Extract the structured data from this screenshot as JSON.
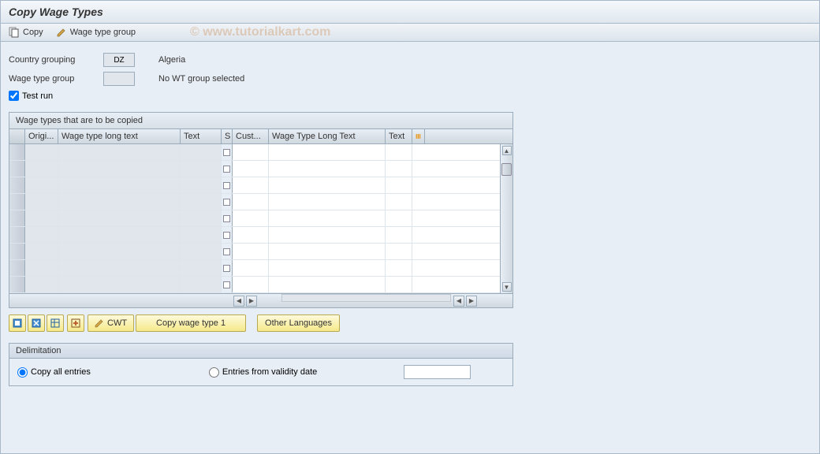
{
  "title": "Copy Wage Types",
  "toolbar": {
    "copy_label": "Copy",
    "wage_type_group_label": "Wage type group"
  },
  "watermark": "© www.tutorialkart.com",
  "form": {
    "country_grouping_label": "Country grouping",
    "country_grouping_value": "DZ",
    "country_grouping_text": "Algeria",
    "wage_type_group_label": "Wage type group",
    "wage_type_group_value": "",
    "wage_type_group_text": "No WT group selected",
    "test_run_label": "Test run",
    "test_run_checked": true
  },
  "table": {
    "title": "Wage types that are to be copied",
    "headers": {
      "origi": "Origi...",
      "long1": "Wage type long text",
      "text1": "Text",
      "s": "S",
      "cust": "Cust...",
      "long2": "Wage Type Long Text",
      "text2": "Text"
    },
    "rows_count": 9
  },
  "buttons": {
    "cwt_label": "CWT",
    "copy_wt1_label": "Copy wage type 1",
    "other_lang_label": "Other Languages"
  },
  "delimitation": {
    "title": "Delimitation",
    "copy_all_label": "Copy all entries",
    "entries_from_label": "Entries from validity date",
    "selected": "copy_all",
    "date_value": ""
  }
}
